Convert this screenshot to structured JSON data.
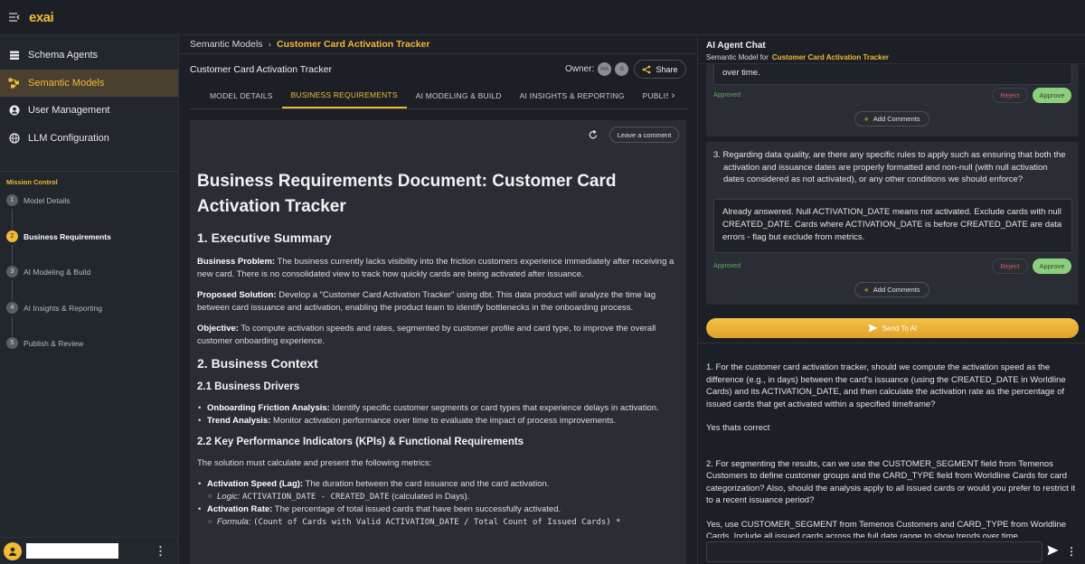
{
  "app": {
    "logo": "exai"
  },
  "sidebar": {
    "items": [
      {
        "label": "Schema Agents",
        "icon": "database-icon"
      },
      {
        "label": "Semantic Models",
        "icon": "semantic-model-icon"
      },
      {
        "label": "User Management",
        "icon": "user-icon"
      },
      {
        "label": "LLM Configuration",
        "icon": "globe-icon"
      }
    ],
    "mission_control": {
      "title": "Mission Control",
      "steps": [
        {
          "num": "1",
          "label": "Model Details"
        },
        {
          "num": "2",
          "label": "Business Requirements"
        },
        {
          "num": "3",
          "label": "AI Modeling & Build"
        },
        {
          "num": "4",
          "label": "AI Insights & Reporting"
        },
        {
          "num": "5",
          "label": "Publish & Review"
        }
      ]
    }
  },
  "breadcrumb": {
    "parent": "Semantic Models",
    "separator": "›",
    "current": "Customer Card Activation Tracker"
  },
  "model": {
    "title": "Customer Card Activation Tracker",
    "owner_label": "Owner:",
    "owners": [
      "HA",
      "S"
    ],
    "share_label": "Share"
  },
  "tabs": [
    "MODEL DETAILS",
    "BUSINESS REQUIREMENTS",
    "AI MODELING & BUILD",
    "AI INSIGHTS & REPORTING",
    "PUBLISH"
  ],
  "doc": {
    "leave_comment": "Leave a comment",
    "h1": "Business Requirements Document: Customer Card Activation Tracker",
    "s1_title": "1. Executive Summary",
    "bp_label": "Business Problem:",
    "bp_text": " The business currently lacks visibility into the friction customers experience immediately after receiving a new card. There is no consolidated view to track how quickly cards are being activated after issuance.",
    "ps_label": "Proposed Solution:",
    "ps_text": " Develop a \"Customer Card Activation Tracker\" using dbt. This data product will analyze the time lag between card issuance and activation, enabling the product team to identify bottlenecks in the onboarding process.",
    "obj_label": "Objective:",
    "obj_text": " To compute activation speeds and rates, segmented by customer profile and card type, to improve the overall customer onboarding experience.",
    "s2_title": "2. Business Context",
    "s21_title": "2.1 Business Drivers",
    "d1_label": "Onboarding Friction Analysis:",
    "d1_text": " Identify specific customer segments or card types that experience delays in activation.",
    "d2_label": "Trend Analysis:",
    "d2_text": " Monitor activation performance over time to evaluate the impact of process improvements.",
    "s22_title": "2.2 Key Performance Indicators (KPIs) & Functional Requirements",
    "kpi_intro": "The solution must calculate and present the following metrics:",
    "k1_label": "Activation Speed (Lag):",
    "k1_text": " The duration between the card issuance and the card activation.",
    "k1_logic_label": "Logic:",
    "k1_logic_code": "ACTIVATION_DATE - CREATED_DATE",
    "k1_logic_text": " (calculated in Days).",
    "k2_label": "Activation Rate:",
    "k2_text": " The percentage of total issued cards that have been successfully activated.",
    "k2_formula_label": "Formula:",
    "k2_formula_code": "(Count of Cards with Valid ACTIVATION_DATE / Total Count of Issued Cards) *"
  },
  "chat": {
    "title": "AI Agent Chat",
    "subtitle_prefix": "Semantic Model for",
    "subtitle_model": "Customer Card Activation Tracker",
    "card1_answer_tail": "over time.",
    "approved_label": "Approved",
    "reject_label": "Reject",
    "approve_label": "Approve",
    "add_comments_label": "Add Comments",
    "q3_text": "3. Regarding data quality, are there any specific rules to apply such as ensuring that both the activation and issuance dates are properly formatted and non-null (with null activation dates considered as not activated), or any other conditions we should enforce?",
    "q3_answer": "Already answered. Null ACTIVATION_DATE means not activated. Exclude cards with null CREATED_DATE. Cards where ACTIVATION_DATE is before CREATED_DATE are data errors - flag but exclude from metrics.",
    "send_label": "Send To AI",
    "log": [
      "1. For the customer card activation tracker, should we compute the activation speed as the difference (e.g., in days) between the card's issuance (using the CREATED_DATE in Worldline Cards) and its ACTIVATION_DATE, and then calculate the activation rate as the percentage of issued cards that get activated within a specified timeframe?",
      "Yes thats correct",
      "2. For segmenting the results, can we use the CUSTOMER_SEGMENT field from Temenos Customers to define customer groups and the CARD_TYPE field from Worldline Cards for card categorization? Also, should the analysis apply to all issued cards or would you prefer to restrict it to a recent issuance period?",
      "Yes, use CUSTOMER_SEGMENT from Temenos Customers and CARD_TYPE from Worldline Cards. Include all issued cards across the full date range to show trends over time."
    ]
  },
  "colors": {
    "accent": "#f3b934",
    "approve": "#8cd07f",
    "reject": "#d85a5a",
    "approved_text": "#62a85e"
  }
}
